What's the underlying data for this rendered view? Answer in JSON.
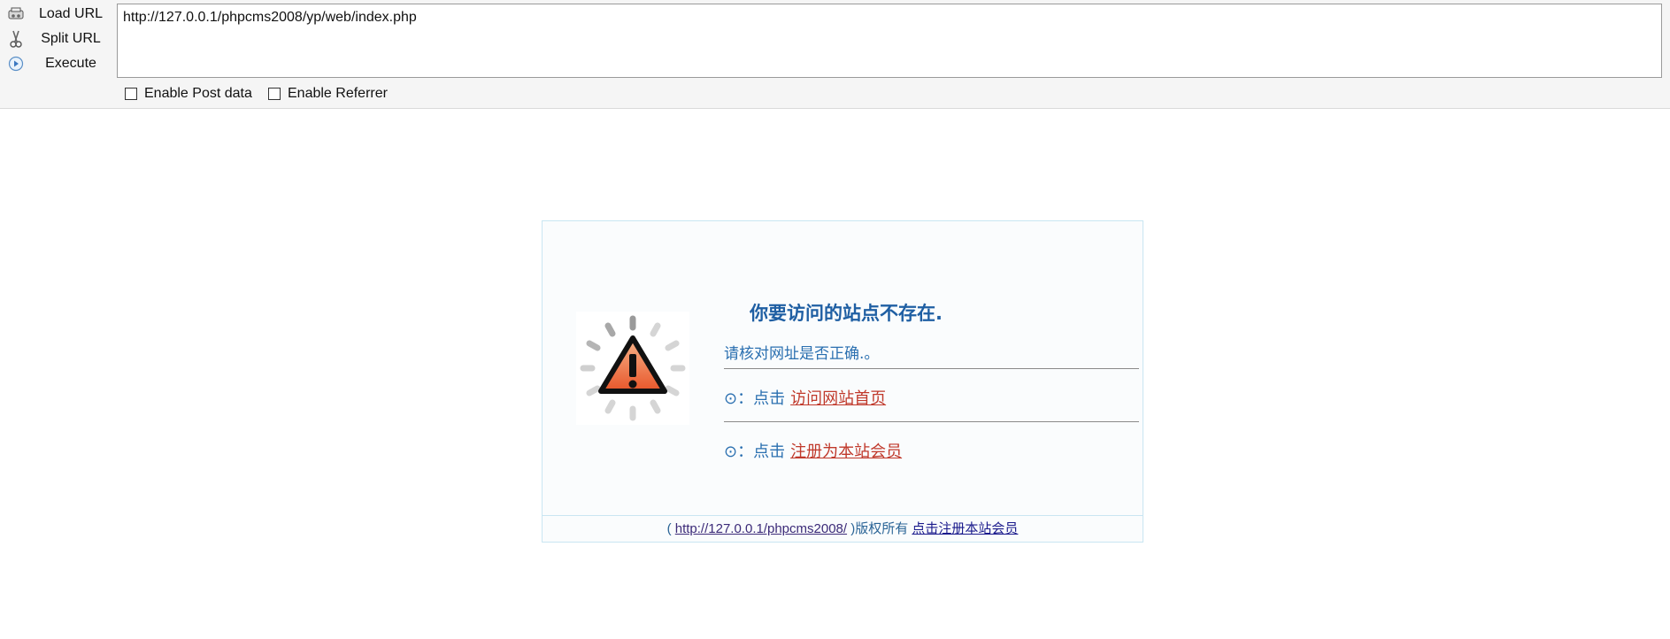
{
  "toolbar": {
    "load_url_label": "Load URL",
    "split_url_label": "Split URL",
    "execute_label": "Execute",
    "url_value": "http://127.0.0.1/phpcms2008/yp/web/index.php",
    "enable_post_label": "Enable Post data",
    "enable_referrer_label": "Enable Referrer",
    "enable_post_checked": false,
    "enable_referrer_checked": false
  },
  "notice": {
    "title": "你要访问的站点不存在.",
    "subtitle": "请核对网址是否正确.。",
    "item1_prefix": "⊙：点击",
    "item1_link": "访问网站首页",
    "item2_prefix": "⊙：点击",
    "item2_link": "注册为本站会员"
  },
  "footer": {
    "open_paren": "(",
    "site_link": "http://127.0.0.1/phpcms2008/",
    "rights_text": ")版权所有",
    "register_link": "点击注册本站会员"
  },
  "icons": {
    "load": "load-url-icon",
    "split": "split-url-icon",
    "execute": "execute-icon",
    "warning": "warning-icon"
  },
  "colors": {
    "title": "#1f5fa3",
    "link": "#c0392b",
    "card_border": "#c9e6f2"
  }
}
